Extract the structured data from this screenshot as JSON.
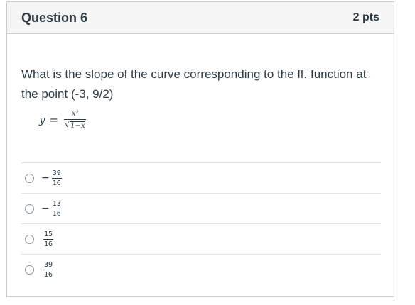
{
  "question": {
    "title": "Question 6",
    "points": "2 pts",
    "prompt": "What is the slope of the curve corresponding to the ff. function at the point (-3,  9/2)"
  },
  "formula": {
    "lhs": "y",
    "equals": "=",
    "numerator": "x²",
    "radical": "√",
    "radicand": "1−x"
  },
  "answers": [
    {
      "sign": "−",
      "numerator": "39",
      "denominator": "16"
    },
    {
      "sign": "−",
      "numerator": "13",
      "denominator": "16"
    },
    {
      "sign": "",
      "numerator": "15",
      "denominator": "16"
    },
    {
      "sign": "",
      "numerator": "39",
      "denominator": "16"
    }
  ]
}
